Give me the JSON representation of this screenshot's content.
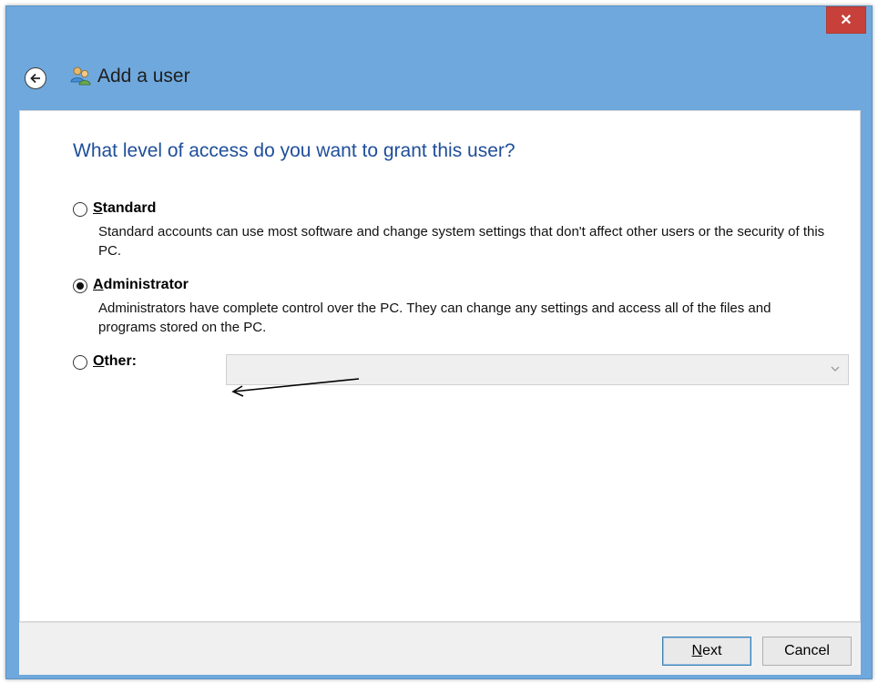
{
  "window": {
    "title": "Add a user",
    "close_symbol": "✕"
  },
  "icons": {
    "back": "back-arrow-icon",
    "title": "users-icon",
    "close": "close-icon",
    "dropdown": "chevron-down-icon"
  },
  "question": "What level of access do you want to grant this user?",
  "options": [
    {
      "first_letter": "S",
      "rest": "tandard",
      "label": "Standard",
      "selected": false,
      "description": "Standard accounts can use most software and change system settings that don't affect other users or the security of this PC."
    },
    {
      "first_letter": "A",
      "rest": "dministrator",
      "label": "Administrator",
      "selected": true,
      "description": "Administrators have complete control over the PC. They can change any settings and access all of the files and programs stored on the PC."
    },
    {
      "first_letter": "O",
      "rest": "ther:",
      "label": "Other:",
      "selected": false,
      "dropdown_value": ""
    }
  ],
  "footer": {
    "next_first": "N",
    "next_rest": "ext",
    "cancel_label": "Cancel"
  },
  "colors": {
    "title_bar": "#6fa8dc",
    "close_button": "#c7413a",
    "question_text": "#1f4e9a"
  }
}
